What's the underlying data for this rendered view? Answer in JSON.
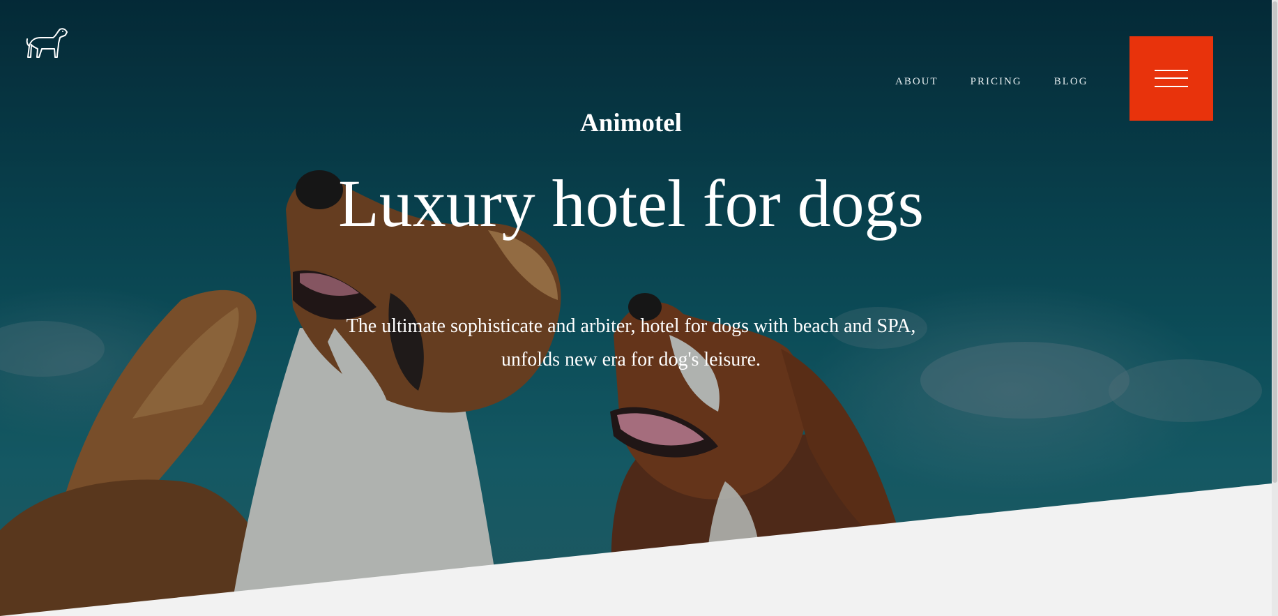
{
  "brand": {
    "name": "Animotel",
    "logo_icon": "dog-icon"
  },
  "nav": {
    "items": [
      {
        "label": "ABOUT"
      },
      {
        "label": "PRICING"
      },
      {
        "label": "BLOG"
      }
    ],
    "menu_icon": "hamburger-menu-icon",
    "menu_color": "#e8330c"
  },
  "hero": {
    "title": "Luxury hotel for dogs",
    "description": "The ultimate sophisticate and arbiter, hotel for dogs with beach and SPA, unfolds new era for dog's leisure.",
    "image_subject": "two-dogs-photo"
  }
}
